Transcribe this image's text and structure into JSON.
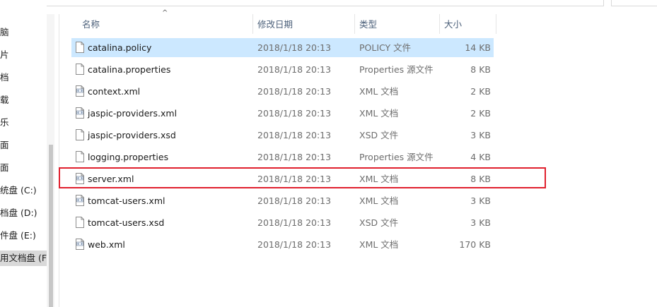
{
  "nav": {
    "items": [
      {
        "label": "脑"
      },
      {
        "label": "片"
      },
      {
        "label": "档"
      },
      {
        "label": "载"
      },
      {
        "label": "乐"
      },
      {
        "label": "面"
      },
      {
        "label": "面"
      },
      {
        "label": "统盘 (C:)"
      },
      {
        "label": "档盘 (D:)"
      },
      {
        "label": "件盘 (E:)"
      },
      {
        "label": "用文档盘 (F:)"
      }
    ]
  },
  "columns": {
    "name": "名称",
    "date": "修改日期",
    "type": "类型",
    "size": "大小",
    "sort_indicator": "^"
  },
  "files": [
    {
      "name": "catalina.policy",
      "date": "2018/1/18 20:13",
      "type": "POLICY 文件",
      "size": "14 KB",
      "icon": "document-icon"
    },
    {
      "name": "catalina.properties",
      "date": "2018/1/18 20:13",
      "type": "Properties 源文件",
      "size": "8 KB",
      "icon": "document-icon"
    },
    {
      "name": "context.xml",
      "date": "2018/1/18 20:13",
      "type": "XML 文档",
      "size": "2 KB",
      "icon": "xml-file-icon"
    },
    {
      "name": "jaspic-providers.xml",
      "date": "2018/1/18 20:13",
      "type": "XML 文档",
      "size": "2 KB",
      "icon": "xml-file-icon"
    },
    {
      "name": "jaspic-providers.xsd",
      "date": "2018/1/18 20:13",
      "type": "XSD 文件",
      "size": "3 KB",
      "icon": "document-icon"
    },
    {
      "name": "logging.properties",
      "date": "2018/1/18 20:13",
      "type": "Properties 源文件",
      "size": "4 KB",
      "icon": "document-icon"
    },
    {
      "name": "server.xml",
      "date": "2018/1/18 20:13",
      "type": "XML 文档",
      "size": "8 KB",
      "icon": "xml-file-icon"
    },
    {
      "name": "tomcat-users.xml",
      "date": "2018/1/18 20:13",
      "type": "XML 文档",
      "size": "3 KB",
      "icon": "xml-file-icon"
    },
    {
      "name": "tomcat-users.xsd",
      "date": "2018/1/18 20:13",
      "type": "XSD 文件",
      "size": "3 KB",
      "icon": "document-icon"
    },
    {
      "name": "web.xml",
      "date": "2018/1/18 20:13",
      "type": "XML 文档",
      "size": "170 KB",
      "icon": "xml-file-icon"
    }
  ],
  "colors": {
    "selected_row": "#cce8ff",
    "highlight_border": "#e0202e",
    "header_text": "#4c607a"
  }
}
